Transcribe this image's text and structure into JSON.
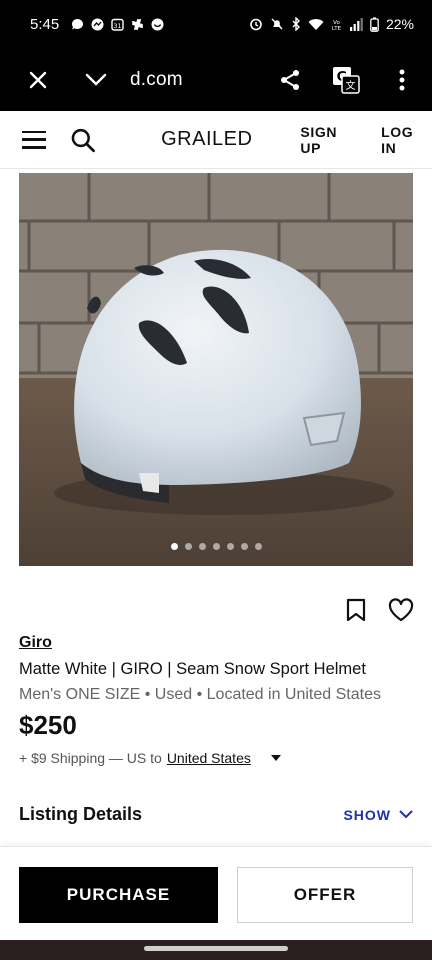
{
  "status_bar": {
    "time": "5:45",
    "battery": "22%",
    "left_icons": [
      "chat-icon",
      "messenger-icon",
      "calendar-icon",
      "slack-icon",
      "tinder-icon"
    ],
    "right_icons": [
      "alarm-icon",
      "mute-icon",
      "bluetooth-icon",
      "wifi-icon",
      "volte-icon",
      "signal-icon",
      "battery-icon"
    ]
  },
  "browser": {
    "url": "d.com"
  },
  "site_header": {
    "logo": "GRAILED",
    "sign_up": "SIGN UP",
    "log_in": "LOG IN"
  },
  "carousel": {
    "dot_count": 7,
    "active_index": 0
  },
  "listing": {
    "brand": "Giro",
    "title": "Matte White | GIRO | Seam Snow Sport Helmet",
    "meta": "Men's ONE SIZE • Used • Located in United States",
    "price": "$250",
    "shipping_prefix": "+ $9 Shipping — US to",
    "shipping_country": "United States",
    "details_label": "Listing Details",
    "details_toggle": "SHOW"
  },
  "footer": {
    "purchase": "PURCHASE",
    "offer": "OFFER"
  }
}
